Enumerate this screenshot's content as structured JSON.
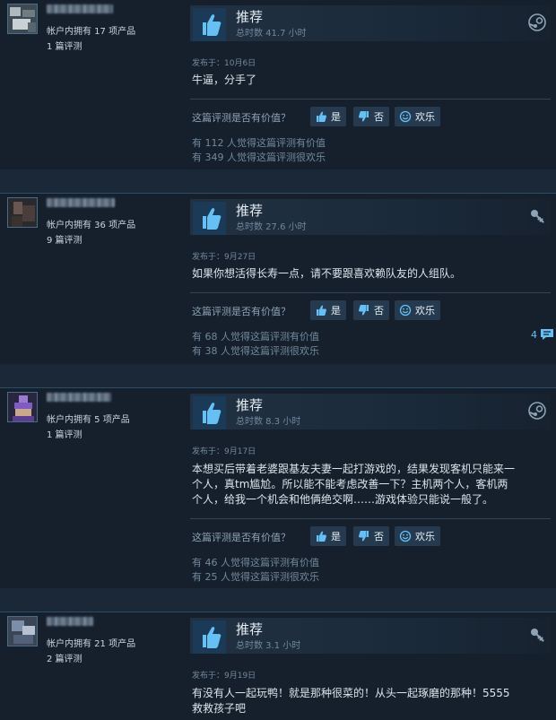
{
  "ui": {
    "recommended": "推荐",
    "helpful_q": "这篇评测是否有价值？",
    "yes": "是",
    "no": "否",
    "funny": "欢乐",
    "accent": "#66c0f4"
  },
  "reviews": [
    {
      "products": "帐户内拥有 17 项产品",
      "reviews_count": "1 篇评测",
      "hours": "总时数 41.7 小时",
      "posted": "发布于：10月6日",
      "text": "牛逼，分手了",
      "helpful": "有 112 人觉得这篇评测有价值",
      "funny": "有 349 人觉得这篇评测很欢乐",
      "source_icon": "steam-icon"
    },
    {
      "products": "帐户内拥有 36 项产品",
      "reviews_count": "9 篇评测",
      "hours": "总时数 27.6 小时",
      "posted": "发布于：9月27日",
      "text": "如果你想活得长寿一点，请不要跟喜欢赖队友的人组队。",
      "helpful": "有 68 人觉得这篇评测有价值",
      "funny": "有 38 人觉得这篇评测很欢乐",
      "comments": "4",
      "source_icon": "key-icon"
    },
    {
      "products": "帐户内拥有 5 项产品",
      "reviews_count": "1 篇评测",
      "hours": "总时数 8.3 小时",
      "posted": "发布于：9月17日",
      "text_lines": [
        "本想买后带着老婆跟基友夫妻一起打游戏的，结果发现客机只能来一",
        "个人，真tm尴尬。所以能不能考虑改善一下？主机两个人，客机两",
        "个人，给我一个机会和他俩绝交啊……游戏体验只能说一般了。"
      ],
      "helpful": "有 46 人觉得这篇评测有价值",
      "funny": "有 25 人觉得这篇评测很欢乐",
      "source_icon": "steam-icon"
    },
    {
      "products": "帐户内拥有 21 项产品",
      "reviews_count": "2 篇评测",
      "hours": "总时数 3.1 小时",
      "posted": "发布于：9月19日",
      "text_lines": [
        "有没有人一起玩鸭！就是那种很菜的！从头一起琢磨的那种！5555",
        "救救孩子吧"
      ],
      "source_icon": "key-icon"
    }
  ]
}
